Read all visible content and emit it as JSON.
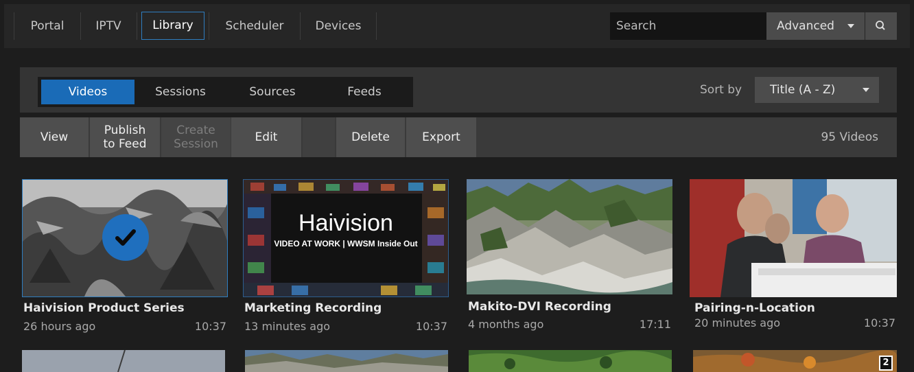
{
  "nav": {
    "tabs": [
      "Portal",
      "IPTV",
      "Library",
      "Scheduler",
      "Devices"
    ],
    "active": "Library",
    "search_placeholder": "Search",
    "advanced_label": "Advanced"
  },
  "filters": {
    "tabs": [
      "Videos",
      "Sessions",
      "Sources",
      "Feeds"
    ],
    "active": "Videos",
    "sort_label": "Sort by",
    "sort_value": "Title (A - Z)"
  },
  "actions": {
    "view": "View",
    "publish_line1": "Publish",
    "publish_line2": "to Feed",
    "create_line1": "Create",
    "create_line2": "Session",
    "edit": "Edit",
    "delete": "Delete",
    "export": "Export",
    "count": "95 Videos"
  },
  "videos": [
    {
      "title": "Haivision Product Series",
      "ago": "26 hours ago",
      "duration": "10:37",
      "selected": true
    },
    {
      "title": "Marketing Recording",
      "ago": "13 minutes ago",
      "duration": "10:37",
      "thumb_brand": "Haivision",
      "thumb_tagline": "VIDEO AT WORK | WWSM Inside Out"
    },
    {
      "title": "Makito-DVI Recording",
      "ago": "4 months ago",
      "duration": "17:11"
    },
    {
      "title": "Pairing-n-Location",
      "ago": "20 minutes ago",
      "duration": "10:37"
    }
  ],
  "row2_badge": "2",
  "colors": {
    "accent": "#1a6bb7",
    "selected_border": "#2f7ec1"
  }
}
